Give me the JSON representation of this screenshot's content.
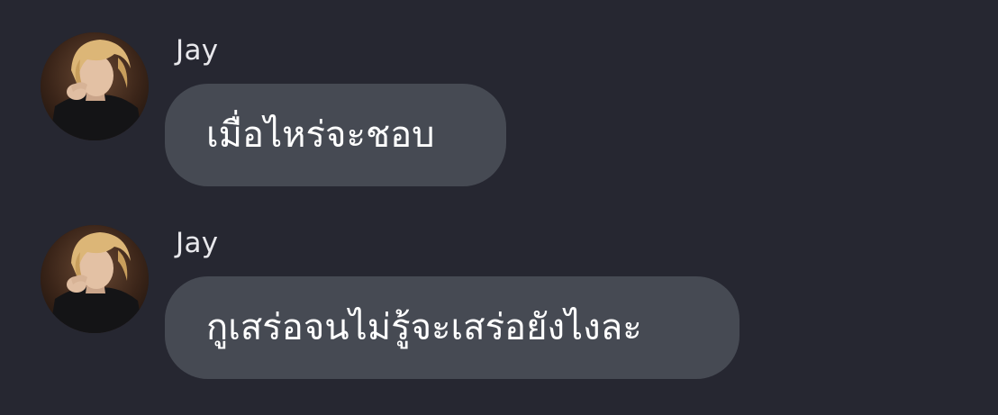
{
  "messages": [
    {
      "sender": "Jay",
      "text": "เมื่อไหร่จะชอบ",
      "avatar_icon": "user-photo-avatar"
    },
    {
      "sender": "Jay",
      "text": "กูเสร่อจนไม่รู้จะเสร่อยังไงละ",
      "avatar_icon": "user-photo-avatar"
    }
  ],
  "colors": {
    "background": "#262731",
    "bubble": "#464a53",
    "text": "#ffffff",
    "sender_name": "#e8e8ec"
  }
}
